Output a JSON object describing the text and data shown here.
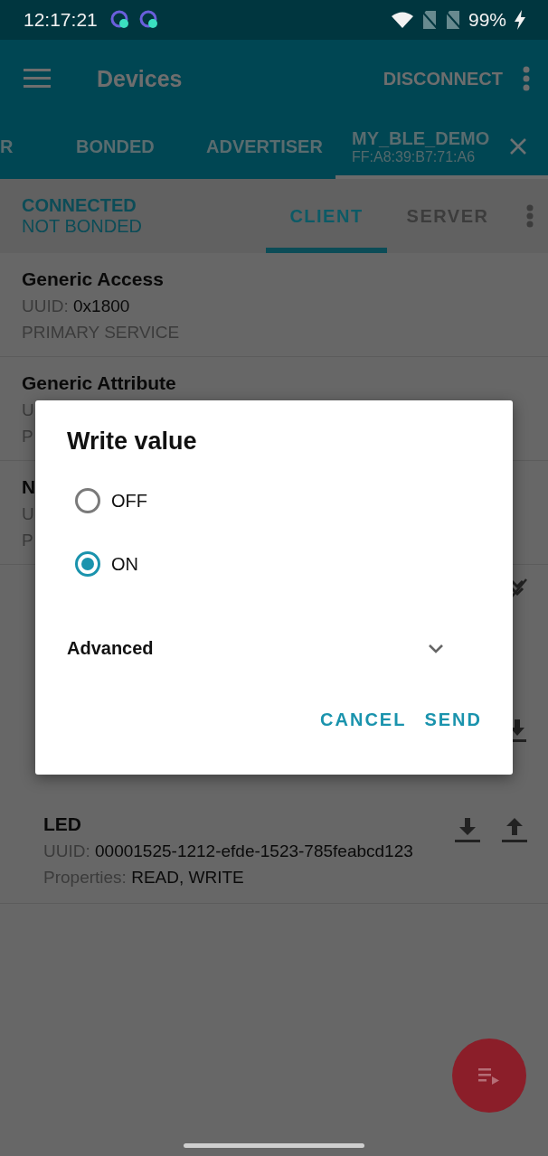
{
  "status_bar": {
    "time": "12:17:21",
    "battery": "99%"
  },
  "app_bar": {
    "title": "Devices",
    "action": "DISCONNECT"
  },
  "device_tabs": [
    {
      "label": "R",
      "selected": false
    },
    {
      "label": "BONDED",
      "selected": false
    },
    {
      "label": "ADVERTISER",
      "selected": false
    },
    {
      "label": "MY_BLE_DEMO",
      "subtitle": "FF:A8:39:B7:71:A6",
      "selected": true
    }
  ],
  "connection": {
    "state": "CONNECTED",
    "bond": "NOT BONDED"
  },
  "mode_tabs": [
    {
      "label": "CLIENT",
      "selected": true
    },
    {
      "label": "SERVER",
      "selected": false
    }
  ],
  "services": [
    {
      "kind": "full",
      "name": "Generic Access",
      "uuid_label": "UUID:",
      "uuid": "0x1800",
      "type": "PRIMARY SERVICE"
    },
    {
      "kind": "partial",
      "name": "Generic Attribute",
      "lines": [
        "U",
        "P"
      ]
    },
    {
      "kind": "partial",
      "name": "N",
      "lines": [
        "U",
        "P"
      ]
    }
  ],
  "characteristic": {
    "name": "LED",
    "uuid_label": "UUID:",
    "uuid": "00001525-1212-efde-1523-785feabcd123",
    "properties_label": "Properties:",
    "properties": "READ, WRITE"
  },
  "dialog": {
    "title": "Write value",
    "options": [
      {
        "label": "OFF",
        "selected": false
      },
      {
        "label": "ON",
        "selected": true
      }
    ],
    "advanced": {
      "label": "Advanced",
      "expanded": false
    },
    "buttons": [
      "CANCEL",
      "SEND"
    ]
  }
}
